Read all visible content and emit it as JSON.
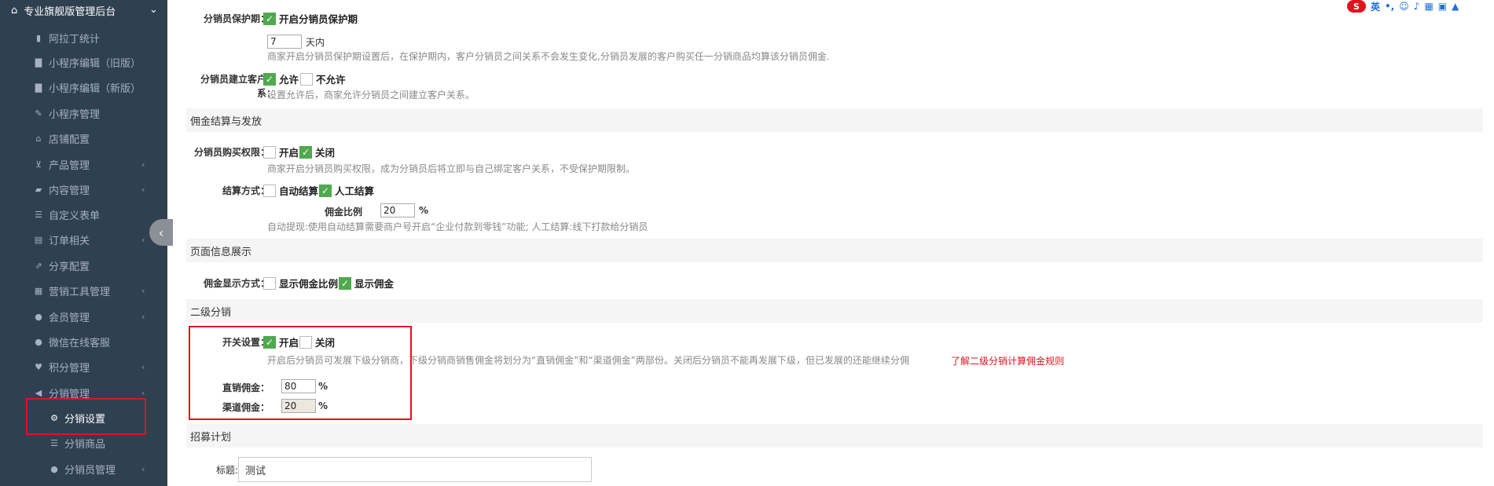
{
  "sidebar": {
    "brand": "专业旗舰版管理后台",
    "items": [
      {
        "label": "阿拉丁统计",
        "icon": "bar-chart-icon",
        "glyph": "▮"
      },
      {
        "label": "小程序编辑（旧版）",
        "icon": "document-icon",
        "glyph": "▇"
      },
      {
        "label": "小程序编辑（新版）",
        "icon": "document-icon",
        "glyph": "▇"
      },
      {
        "label": "小程序管理",
        "icon": "wrench-icon",
        "glyph": "✎"
      },
      {
        "label": "店铺配置",
        "icon": "home-icon",
        "glyph": "⌂"
      },
      {
        "label": "产品管理",
        "icon": "cart-icon",
        "glyph": "⊻"
      },
      {
        "label": "内容管理",
        "icon": "folder-icon",
        "glyph": "▰"
      },
      {
        "label": "自定义表单",
        "icon": "list-icon",
        "glyph": "☰"
      },
      {
        "label": "订单相关",
        "icon": "list-alt-icon",
        "glyph": "▤"
      },
      {
        "label": "分享配置",
        "icon": "share-icon",
        "glyph": "⇗"
      },
      {
        "label": "营销工具管理",
        "icon": "grid-icon",
        "glyph": "▦"
      },
      {
        "label": "会员管理",
        "icon": "user-icon",
        "glyph": "●"
      },
      {
        "label": "微信在线客服",
        "icon": "user-icon",
        "glyph": "●"
      },
      {
        "label": "积分管理",
        "icon": "heart-icon",
        "glyph": "♥"
      },
      {
        "label": "分销管理",
        "icon": "bullhorn-icon",
        "glyph": "◀"
      },
      {
        "label": "分销设置",
        "icon": "gear-icon",
        "glyph": "⚙"
      },
      {
        "label": "分销商品",
        "icon": "list-icon",
        "glyph": "☰"
      },
      {
        "label": "分销员管理",
        "icon": "user-icon",
        "glyph": "●"
      }
    ]
  },
  "protect": {
    "label": "分销员保护期：",
    "option": "开启分销员保护期",
    "days": "7",
    "days_unit": "天内",
    "help": "商家开启分销员保护期设置后，在保护期内，客户分销员之间关系不会发生变化,分销员发展的客户购买任一分销商品均算该分销员佣金."
  },
  "relation": {
    "label_line1": "分销员建立客户关",
    "label_line2": "系：",
    "allow": "允许",
    "deny": "不允许",
    "help": "设置允许后，商家允许分销员之间建立客户关系。"
  },
  "settle_section": "佣金结算与发放",
  "purchase": {
    "label": "分销员购买权限：",
    "on": "开启",
    "off": "关闭",
    "help": "商家开启分销员购买权限，成为分销员后将立即与自己绑定客户关系，不受保护期限制。"
  },
  "settle": {
    "label": "结算方式：",
    "auto": "自动结算",
    "manual": "人工结算",
    "ratio_label": "佣金比例",
    "ratio": "20",
    "ratio_unit": "%",
    "help": "自动提现:使用自动结算需要商户号开启“企业付款到零钱”功能; 人工结算:线下打款给分销员"
  },
  "display_section": "页面信息展示",
  "display": {
    "label": "佣金显示方式：",
    "ratio": "显示佣金比例",
    "amount": "显示佣金"
  },
  "level2_section": "二级分销",
  "level2": {
    "label": "开关设置：",
    "on": "开启",
    "off": "关闭",
    "help": "开启后分销员可发展下级分销商，下级分销商销售佣金将划分为“直销佣金”和“渠道佣金”两部份。关闭后分销员不能再发展下级，但已发展的还能继续分佣",
    "link": "了解二级分销计算佣金规则",
    "direct_label": "直销佣金：",
    "direct": "80",
    "channel_label": "渠道佣金：",
    "channel": "20",
    "unit": "%"
  },
  "recruit_section": "招募计划",
  "recruit": {
    "title_label": "标题:",
    "title_value": "测试"
  },
  "ime": {
    "logo": "S",
    "lang": "英"
  }
}
